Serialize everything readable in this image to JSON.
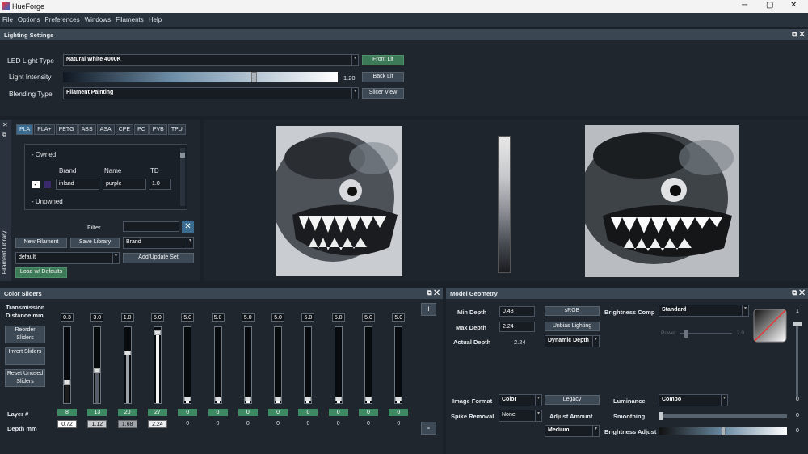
{
  "app": {
    "title": "HueForge"
  },
  "menu": [
    "File",
    "Options",
    "Preferences",
    "Windows",
    "Filaments",
    "Help"
  ],
  "lighting": {
    "header": "Lighting Settings",
    "led_label": "LED Light Type",
    "led_value": "Natural White 4000K",
    "intensity_label": "Light Intensity",
    "intensity_value": "1.20",
    "intensity_fraction": 0.7,
    "blending_label": "Blending Type",
    "blending_value": "Filament Painting",
    "front_lit": "Front Lit",
    "back_lit": "Back Lit",
    "slicer_view": "Slicer View"
  },
  "library": {
    "side_label": "Filament Library",
    "tabs": [
      "PLA",
      "PLA+",
      "PETG",
      "ABS",
      "ASA",
      "CPE",
      "PC",
      "PVB",
      "TPU"
    ],
    "owned": "- Owned",
    "unowned": "- Unowned",
    "col_brand": "Brand",
    "col_name": "Name",
    "col_td": "TD",
    "row_brand": "inland",
    "row_name": "purple",
    "row_td": "1.0",
    "filter_label": "Filter",
    "new_filament": "New Filament",
    "save_library": "Save Library",
    "brand_select": "Brand",
    "profile": "default",
    "add_update": "Add/Update Set",
    "load_defaults": "Load w/ Defaults"
  },
  "sliders": {
    "header": "Color Sliders",
    "transmission_label": "Transmission Distance mm",
    "reorder": "Reorder Sliders",
    "invert": "Invert Sliders",
    "reset": "Reset Unused Sliders",
    "layer_label": "Layer #",
    "depth_label": "Depth mm",
    "plus": "+",
    "minus": "-",
    "td": [
      "0.3",
      "3.0",
      "1.0",
      "5.0",
      "5.0",
      "5.0",
      "5.0",
      "5.0",
      "5.0",
      "5.0",
      "5.0",
      "5.0"
    ],
    "layers": [
      "8",
      "13",
      "20",
      "27",
      "0",
      "0",
      "0",
      "0",
      "0",
      "0",
      "0",
      "0"
    ],
    "depths": [
      "0.72",
      "1.12",
      "1.68",
      "2.24",
      "0",
      "0",
      "0",
      "0",
      "0",
      "0",
      "0",
      "0"
    ],
    "levels": [
      0.26,
      0.42,
      0.67,
      0.95,
      0.02,
      0.02,
      0.02,
      0.02,
      0.02,
      0.02,
      0.02,
      0.02
    ],
    "colors": [
      "#1c1c1c",
      "#555d66",
      "#9aa1a8",
      "#f2f2f2",
      "#fff",
      "#fff",
      "#fff",
      "#fff",
      "#fff",
      "#fff",
      "#fff",
      "#fff"
    ]
  },
  "geometry": {
    "header": "Model Geometry",
    "min_depth_label": "Min Depth",
    "min_depth": "0.48",
    "max_depth_label": "Max Depth",
    "max_depth": "2.24",
    "actual_depth_label": "Actual Depth",
    "actual_depth": "2.24",
    "srgb": "sRGB",
    "unbias": "Unbias Lighting",
    "dynamic_depth": "Dynamic Depth",
    "brightness_comp_label": "Brightness Comp",
    "brightness_comp": "Standard",
    "power_label": "Power",
    "power_value": "2.0",
    "curve_top": "1",
    "curve_bottom": "0",
    "image_format_label": "Image Format",
    "image_format": "Color",
    "legacy": "Legacy",
    "luminance_label": "Luminance",
    "luminance": "Combo",
    "spike_label": "Spike Removal",
    "spike": "None",
    "adjust_label": "Adjust Amount",
    "smoothing_label": "Smoothing",
    "smoothing_value": "0",
    "adjust_select": "Medium",
    "brightness_adjust_label": "Brightness Adjust",
    "brightness_adjust_value": "0",
    "luminance_value": "0"
  }
}
